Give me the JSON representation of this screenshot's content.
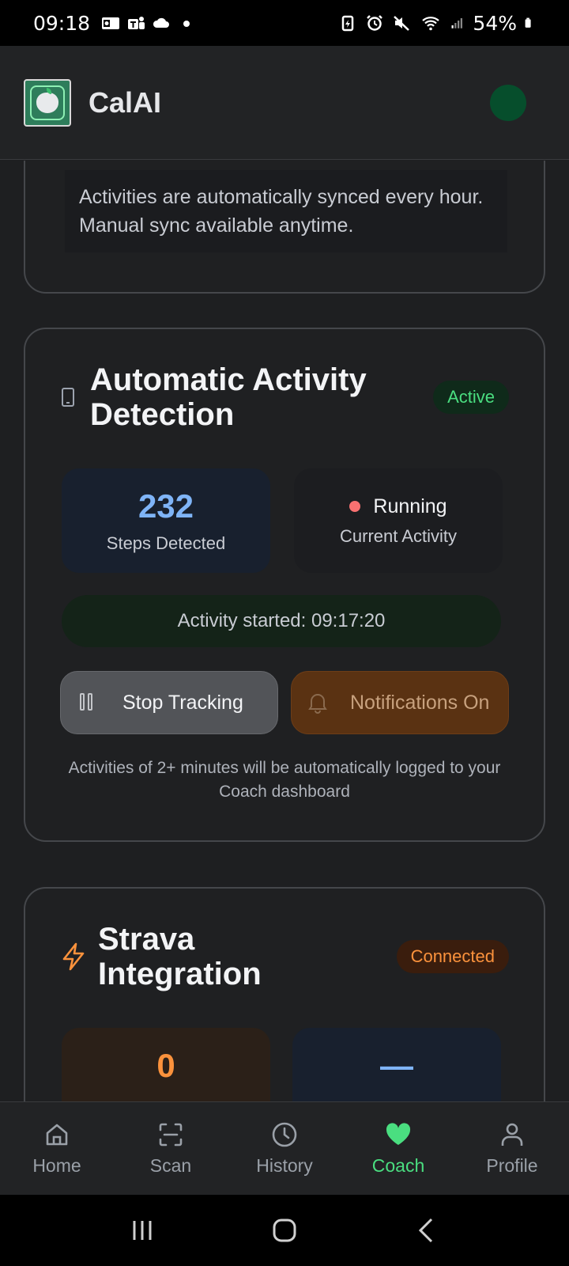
{
  "status_bar": {
    "time": "09:18",
    "battery_pct": "54%",
    "left_icons": [
      "outlook-icon",
      "teams-icon",
      "cloud-icon",
      "dot-icon"
    ],
    "right_icons": [
      "battery-saver-icon",
      "alarm-icon",
      "mute-icon",
      "wifi-icon",
      "signal-icon",
      "battery-icon"
    ]
  },
  "app": {
    "title": "CalAI"
  },
  "sync_card": {
    "note": "Activities are automatically synced every hour. Manual sync available anytime."
  },
  "detection_card": {
    "title": "Automatic Activity Detection",
    "badge": "Active",
    "steps_value": "232",
    "steps_label": "Steps Detected",
    "activity_value": "Running",
    "activity_label": "Current Activity",
    "started": "Activity started: 09:17:20",
    "stop_button": "Stop Tracking",
    "notif_button": "Notifications On",
    "footnote": "Activities of 2+ minutes will be automatically logged to your Coach dashboard"
  },
  "strava_card": {
    "title": "Strava Integration",
    "badge": "Connected",
    "stat1_value": "0",
    "stat2_value": "—"
  },
  "bottom_nav": {
    "items": [
      {
        "label": "Home",
        "icon": "home-icon"
      },
      {
        "label": "Scan",
        "icon": "scan-icon"
      },
      {
        "label": "History",
        "icon": "clock-icon"
      },
      {
        "label": "Coach",
        "icon": "heart-icon",
        "active": true
      },
      {
        "label": "Profile",
        "icon": "user-icon"
      }
    ]
  },
  "colors": {
    "accent_green": "#4ade80",
    "accent_orange": "#fb923c",
    "accent_blue": "#7fb4f7",
    "background": "#1e1f21"
  }
}
